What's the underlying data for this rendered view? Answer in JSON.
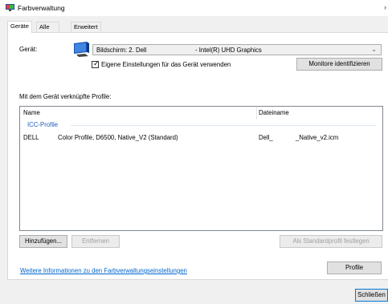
{
  "window": {
    "title": "Farbverwaltung",
    "close_glyph": "›"
  },
  "tabs": [
    {
      "label": "Geräte",
      "active": true
    },
    {
      "label": "Alle Profile",
      "active": false
    },
    {
      "label": "Erweitert",
      "active": false
    }
  ],
  "device": {
    "label": "Gerät:",
    "selected_device": "Bildschirm: 2. Dell",
    "selected_adapter": "- Intel(R) UHD Graphics",
    "dropdown_icon": "chevron-down-icon",
    "custom_settings_label": "Eigene Einstellungen für das Gerät verwenden",
    "custom_settings_checked": true,
    "identify_button": "Monitore identifizieren"
  },
  "profiles_section": {
    "label": "Mit dem Gerät verknüpfte Profile:",
    "columns": [
      "Name",
      "Dateiname"
    ],
    "group": "ICC-Profile",
    "rows": [
      {
        "name": "DELL           Color Profile, D6500, Native_V2 (Standard)",
        "filename": "Dell_             _Native_v2.icm"
      }
    ]
  },
  "actions": {
    "add": "Hinzufügen...",
    "remove": "Entfernen",
    "set_default": "Als Standardprofil festlegen",
    "profile": "Profile"
  },
  "footer": {
    "info_link": "Weitere Informationen zu den Farbverwaltungseinstellungen",
    "close": "Schließen"
  },
  "colors": {
    "link": "#0066cc",
    "group_header": "#1e5ebf",
    "accent": "#0078d7"
  }
}
